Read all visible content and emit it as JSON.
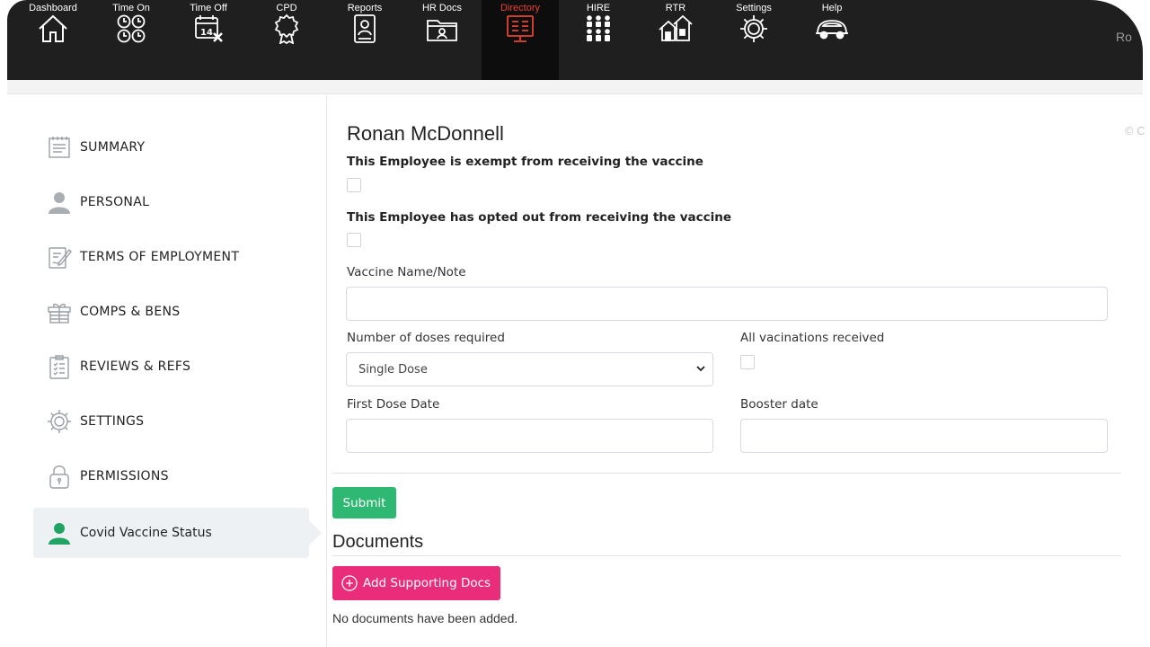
{
  "nav": {
    "items": [
      {
        "label": "Dashboard",
        "icon": "house-icon"
      },
      {
        "label": "Time On",
        "icon": "clock-grid-icon"
      },
      {
        "label": "Time Off",
        "icon": "calendar-x-icon"
      },
      {
        "label": "CPD",
        "icon": "award-icon"
      },
      {
        "label": "Reports",
        "icon": "report-icon"
      },
      {
        "label": "HR Docs",
        "icon": "folder-icon"
      },
      {
        "label": "Directory",
        "icon": "directory-icon"
      },
      {
        "label": "HIRE",
        "icon": "people-grid-icon"
      },
      {
        "label": "RTR",
        "icon": "houses-icon"
      },
      {
        "label": "Settings",
        "icon": "gear-icon"
      },
      {
        "label": "Help",
        "icon": "car-icon"
      }
    ],
    "active": "Directory",
    "user_fragment": "Ro"
  },
  "sidebar": {
    "items": [
      {
        "label": "SUMMARY",
        "icon": "summary-icon"
      },
      {
        "label": "PERSONAL",
        "icon": "person-icon"
      },
      {
        "label": "TERMS OF EMPLOYMENT",
        "icon": "contract-icon"
      },
      {
        "label": "COMPS & BENS",
        "icon": "gift-icon"
      },
      {
        "label": "REVIEWS & REFS",
        "icon": "checklist-icon"
      },
      {
        "label": "SETTINGS",
        "icon": "gear-icon"
      },
      {
        "label": "PERMISSIONS",
        "icon": "lock-icon"
      },
      {
        "label": "Covid Vaccine Status",
        "icon": "person-green-icon"
      }
    ],
    "active": "Covid Vaccine Status"
  },
  "main": {
    "copyright": "© C",
    "employee_name": "Ronan McDonnell",
    "exempt_label": "This Employee is exempt from receiving the vaccine",
    "optout_label": "This Employee has opted out from receiving the vaccine",
    "vaccine_name_label": "Vaccine Name/Note",
    "vaccine_name_value": "",
    "doses_label": "Number of doses required",
    "doses_value": "Single Dose",
    "all_received_label": "All vacinations received",
    "first_dose_label": "First Dose Date",
    "first_dose_value": "",
    "booster_label": "Booster date",
    "booster_value": "",
    "submit_label": "Submit",
    "documents_title": "Documents",
    "add_docs_label": "Add Supporting Docs",
    "no_docs_text": "No documents have been added."
  },
  "colors": {
    "nav_bg": "#1f1f1f",
    "active_nav_text": "#e8432f",
    "submit_green": "#2eb872",
    "add_pink": "#ea2d7a",
    "active_side_icon": "#1fa463"
  }
}
